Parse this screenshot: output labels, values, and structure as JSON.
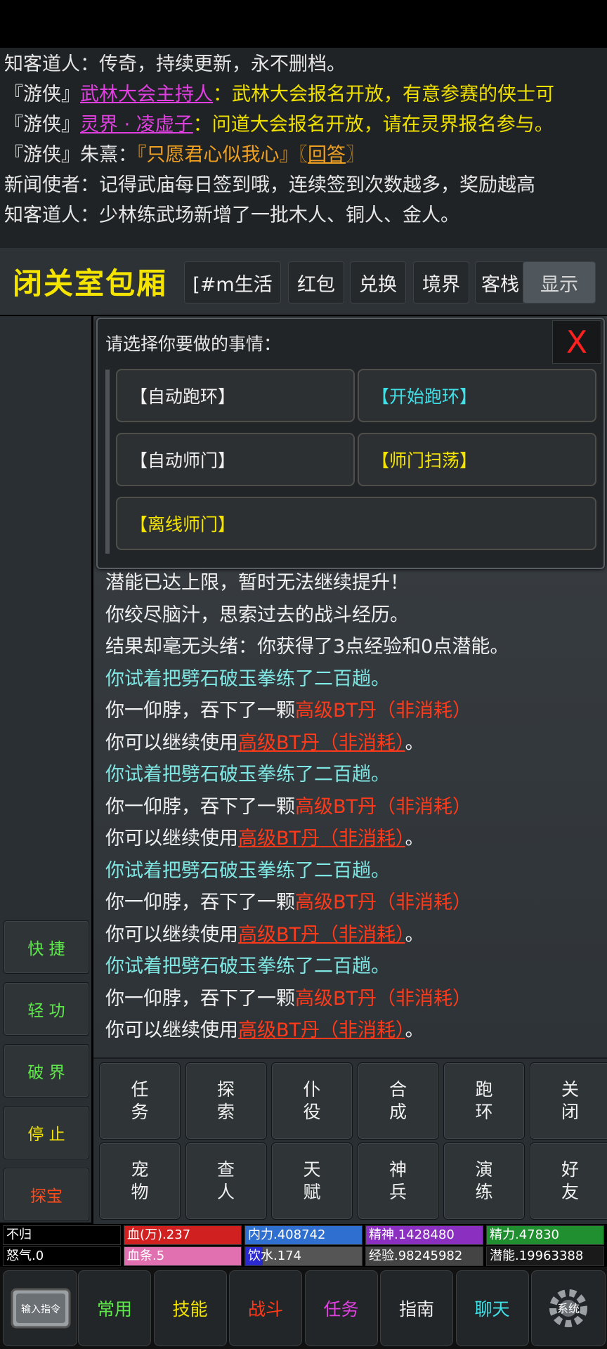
{
  "chat": [
    {
      "parts": [
        {
          "t": "知客道人：传奇，持续更新，永不删档。",
          "c": "w"
        }
      ]
    },
    {
      "parts": [
        {
          "t": "『游侠』",
          "c": "w"
        },
        {
          "t": "武林大会主持人",
          "c": "m"
        },
        {
          "t": "：武林大会报名开放，有意参赛的侠士可",
          "c": "y"
        }
      ]
    },
    {
      "parts": [
        {
          "t": "『游侠』",
          "c": "w"
        },
        {
          "t": "灵界 · 凌虚子",
          "c": "m"
        },
        {
          "t": "：问道大会报名开放，请在灵界报名参与。",
          "c": "y"
        }
      ]
    },
    {
      "parts": [
        {
          "t": "『游侠』朱熹：",
          "c": "w"
        },
        {
          "t": "『只愿君心似我心』〖",
          "c": "o"
        },
        {
          "t": "回答",
          "c": "ol"
        },
        {
          "t": "〗",
          "c": "o"
        }
      ]
    },
    {
      "parts": [
        {
          "t": "新闻使者：记得武庙每日签到哦，连续签到次数越多，奖励越高",
          "c": "w"
        }
      ]
    },
    {
      "parts": [
        {
          "t": "知客道人：少林练武场新增了一批木人、铜人、金人。",
          "c": "w"
        }
      ]
    }
  ],
  "header": {
    "title": "闭关室包厢",
    "tabs": [
      "[#m生活",
      "红包",
      "兑换",
      "境界",
      "客栈"
    ],
    "show_label": "显示"
  },
  "dialog": {
    "title": "请选择你要做的事情：",
    "close_label": "X",
    "options": [
      {
        "label": "【自动跑环】",
        "color": "#f0f0f0"
      },
      {
        "label": "【开始跑环】",
        "color": "#40e0e8"
      },
      {
        "label": "【自动师门】",
        "color": "#f0f0f0"
      },
      {
        "label": "【师门扫荡】",
        "color": "#f5e400"
      },
      {
        "label": "【离线师门】",
        "color": "#f5e400"
      }
    ]
  },
  "log": [
    [
      {
        "t": "潜能已达上限，暂时无法继续提升！",
        "c": "lw"
      }
    ],
    [
      {
        "t": "你绞尽脑汁，思索过去的战斗经历。",
        "c": "lw"
      }
    ],
    [
      {
        "t": "结果却毫无头绪：你获得了3点经验和0点潜能。",
        "c": "lw"
      }
    ],
    [
      {
        "t": "你试着把劈石破玉拳练了二百趟。",
        "c": "lc"
      }
    ],
    [
      {
        "t": "你一仰脖，吞下了一颗",
        "c": "lw"
      },
      {
        "t": "高级BT丹（非消耗）",
        "c": "lr"
      }
    ],
    [
      {
        "t": "你可以继续使用",
        "c": "lw"
      },
      {
        "t": "高级BT丹（非消耗）",
        "c": "lru"
      },
      {
        "t": "。",
        "c": "lw"
      }
    ],
    [
      {
        "t": "你试着把劈石破玉拳练了二百趟。",
        "c": "lc"
      }
    ],
    [
      {
        "t": "你一仰脖，吞下了一颗",
        "c": "lw"
      },
      {
        "t": "高级BT丹（非消耗）",
        "c": "lr"
      }
    ],
    [
      {
        "t": "你可以继续使用",
        "c": "lw"
      },
      {
        "t": "高级BT丹（非消耗）",
        "c": "lru"
      },
      {
        "t": "。",
        "c": "lw"
      }
    ],
    [
      {
        "t": "你试着把劈石破玉拳练了二百趟。",
        "c": "lc"
      }
    ],
    [
      {
        "t": "你一仰脖，吞下了一颗",
        "c": "lw"
      },
      {
        "t": "高级BT丹（非消耗）",
        "c": "lr"
      }
    ],
    [
      {
        "t": "你可以继续使用",
        "c": "lw"
      },
      {
        "t": "高级BT丹（非消耗）",
        "c": "lru"
      },
      {
        "t": "。",
        "c": "lw"
      }
    ],
    [
      {
        "t": "你试着把劈石破玉拳练了二百趟。",
        "c": "lc"
      }
    ],
    [
      {
        "t": "你一仰脖，吞下了一颗",
        "c": "lw"
      },
      {
        "t": "高级BT丹（非消耗）",
        "c": "lr"
      }
    ],
    [
      {
        "t": "你可以继续使用",
        "c": "lw"
      },
      {
        "t": "高级BT丹（非消耗）",
        "c": "lru"
      },
      {
        "t": "。",
        "c": "lw"
      }
    ]
  ],
  "side_buttons": [
    {
      "label": "快 捷",
      "color": "#5ee84a"
    },
    {
      "label": "轻 功",
      "color": "#5ee84a"
    },
    {
      "label": "破 界",
      "color": "#5ee84a"
    },
    {
      "label": "停 止",
      "color": "#f5e400"
    },
    {
      "label": "探宝",
      "color": "#ff4a1a"
    }
  ],
  "actions": [
    [
      "任\n务",
      "探\n索",
      "仆\n役",
      "合\n成",
      "跑\n环",
      "关\n闭"
    ],
    [
      "宠\n物",
      "查\n人",
      "天\n赋",
      "神\n兵",
      "演\n练",
      "好\n友"
    ]
  ],
  "stats": [
    [
      {
        "label": "不归",
        "color": "#000000"
      },
      {
        "label": "血(万).237",
        "color": "#d02020"
      },
      {
        "label": "内力.408742",
        "color": "#2f6fd0"
      },
      {
        "label": "精神.1428480",
        "color": "#8a2fc0"
      },
      {
        "label": "精力.47830",
        "color": "#1f8f2f"
      }
    ],
    [
      {
        "label": "怒气.0",
        "color": "#000000"
      },
      {
        "label": "血条.5",
        "color": "#e070b0"
      },
      {
        "label": "饮水.174",
        "color": "#2a2ad0"
      },
      {
        "label": "经验.98245982",
        "color": "#444444"
      },
      {
        "label": "潜能.19963388",
        "color": "#1a1a1a"
      }
    ]
  ],
  "bottom_nav": {
    "input_label": "输入指令",
    "tabs": [
      {
        "label": "常用",
        "color": "#5ee84a"
      },
      {
        "label": "技能",
        "color": "#f5e400"
      },
      {
        "label": "战斗",
        "color": "#ff3a1a"
      },
      {
        "label": "任务",
        "color": "#e040e0"
      },
      {
        "label": "指南",
        "color": "#f0f0f0"
      },
      {
        "label": "聊天",
        "color": "#40e0e8"
      }
    ],
    "system_label": "系统"
  }
}
